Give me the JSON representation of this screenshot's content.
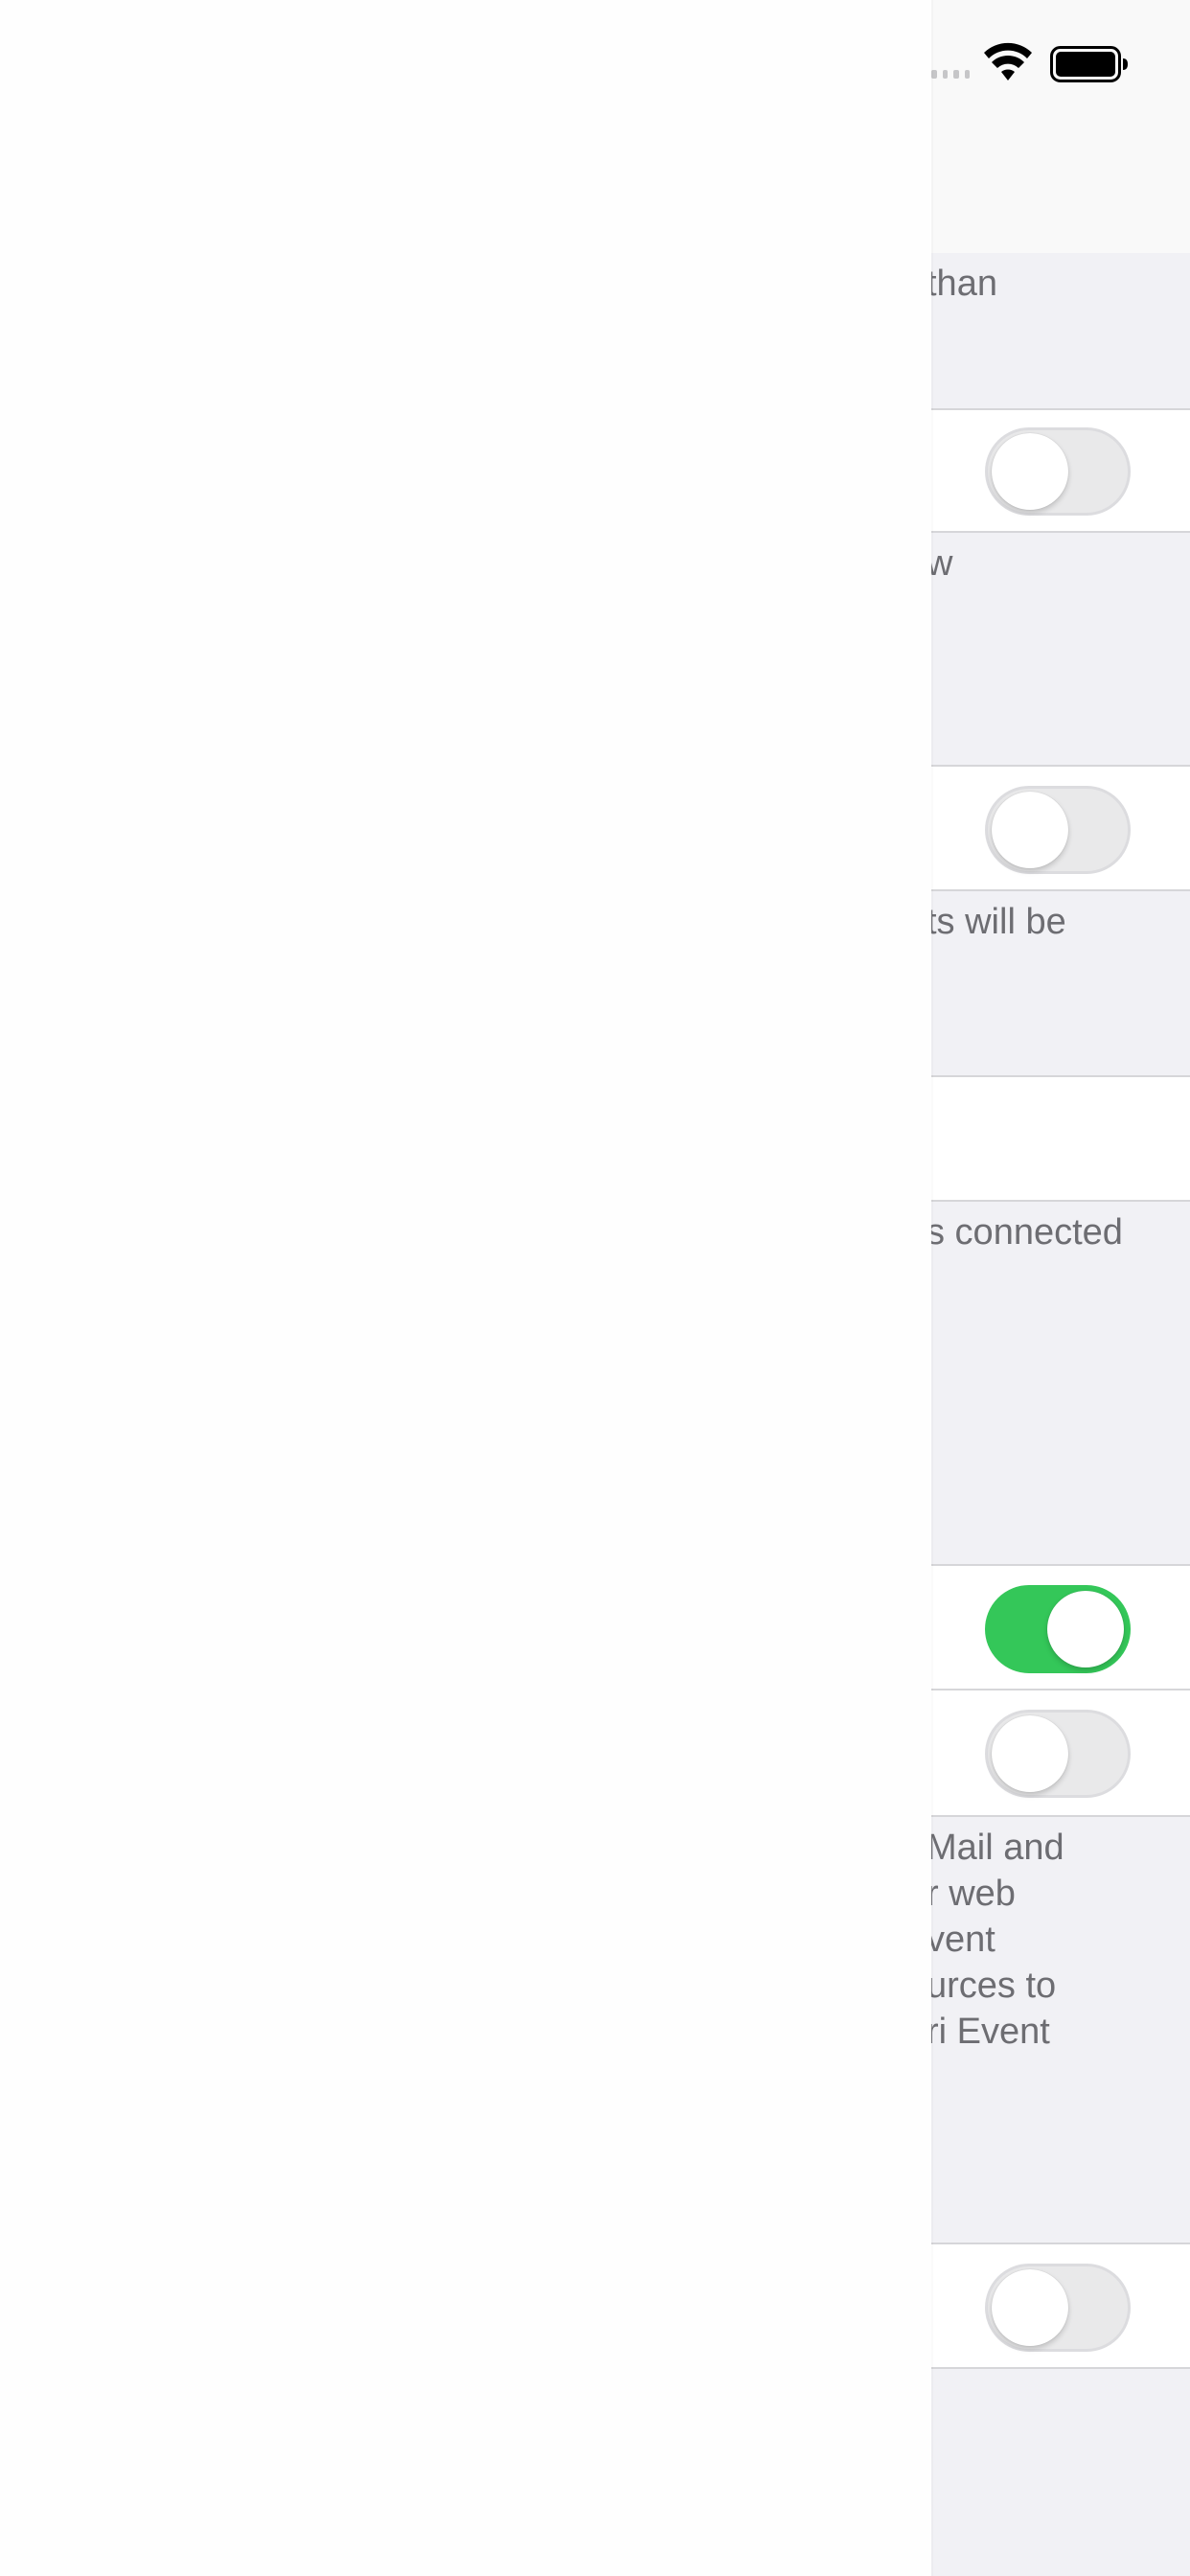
{
  "status_bar": {
    "signal_icon": "signal-dots-icon",
    "wifi_icon": "wifi-icon",
    "battery_icon": "battery-icon"
  },
  "sections": {
    "footer1": "than",
    "footer2": "w",
    "footer3": "ts will be",
    "footer4": "s connected",
    "footer5": "Mail and\nr web\nvent\nurces to\nri Event"
  },
  "toggles": {
    "toggle1": false,
    "toggle2": false,
    "toggle3": true,
    "toggle4": false,
    "toggle5": false
  },
  "colors": {
    "toggle_on": "#34c759",
    "toggle_off": "#e9e9ea",
    "footer_text": "#6d6d72",
    "group_background": "#f1f1f5"
  }
}
